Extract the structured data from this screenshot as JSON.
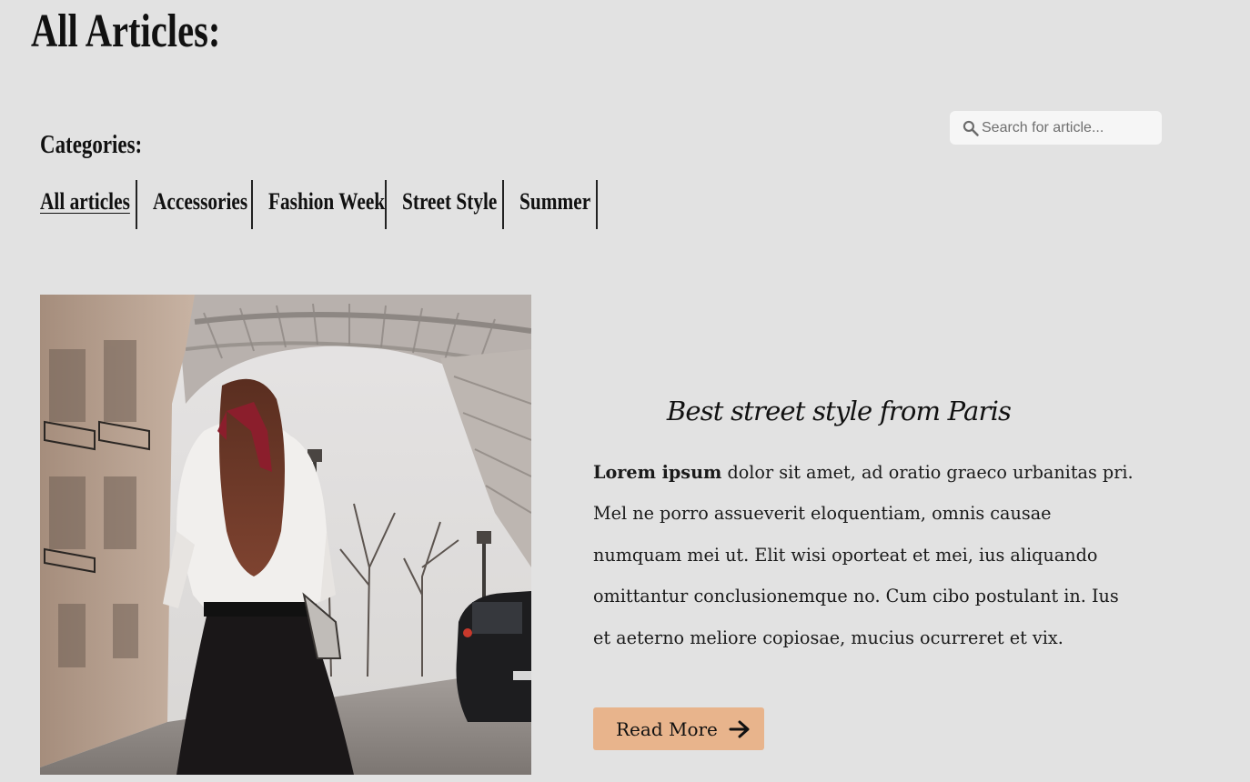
{
  "page": {
    "title": "All Articles:"
  },
  "categories": {
    "title": "Categories:",
    "items": [
      {
        "label": "All articles",
        "active": true
      },
      {
        "label": "Accessories",
        "active": false
      },
      {
        "label": "Fashion Week",
        "active": false
      },
      {
        "label": "Street Style",
        "active": false
      },
      {
        "label": "Summer",
        "active": false
      }
    ]
  },
  "search": {
    "placeholder": "Search for article...",
    "value": "",
    "icon": "search-icon"
  },
  "article": {
    "title": "Best street style from Paris",
    "body_lead": "Lorem ipsum",
    "body_rest": " dolor sit amet, ad oratio graeco urbanitas pri. Mel ne porro assueverit eloquentiam, omnis causae numquam mei ut. Elit wisi oporteat et mei, ius aliquando omittantur conclusionemque no. Cum cibo postulant in. Ius et aeterno meliore copiosae, mucius ocurreret et vix.",
    "image_alt": "Woman with red hair ribbon walking toward the Eiffel Tower",
    "read_more_label": "Read More",
    "read_more_icon": "arrow-right-icon"
  },
  "colors": {
    "background": "#e2e2e2",
    "button": "#e8b48c",
    "search_bg": "#f6f6f6"
  }
}
